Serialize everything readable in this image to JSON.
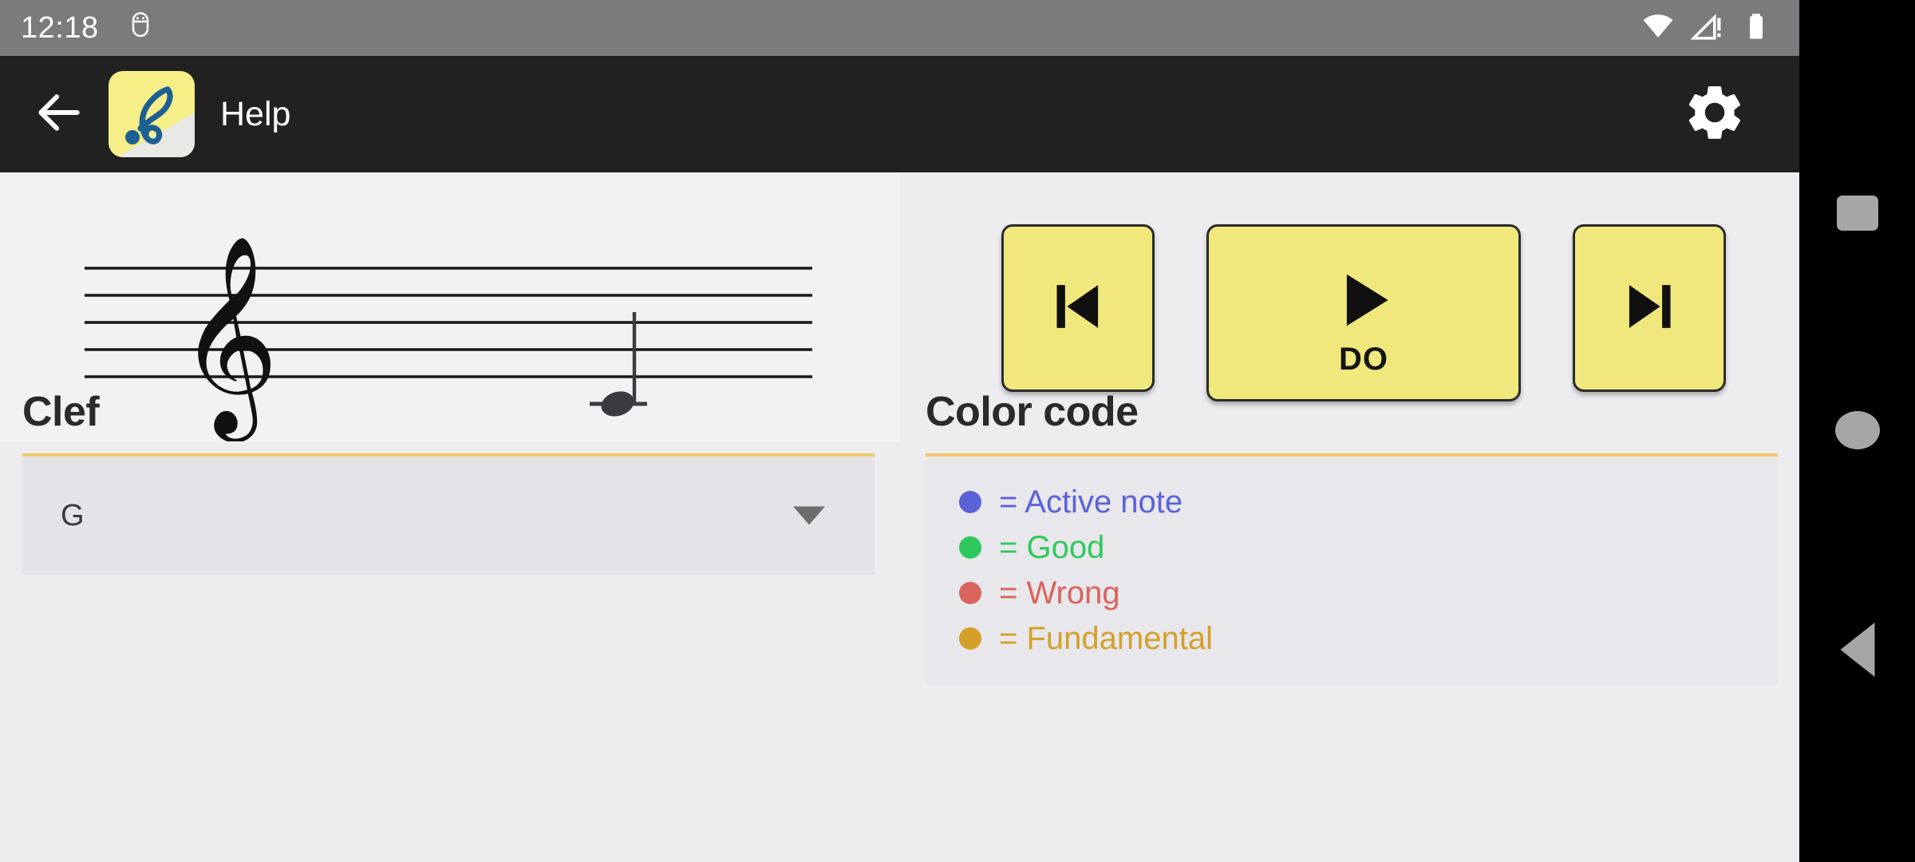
{
  "status_bar": {
    "clock": "12:18",
    "icons": [
      "android-head-icon",
      "wifi-icon",
      "cellular-no-sim-icon",
      "battery-full-icon"
    ]
  },
  "toolbar": {
    "back_icon": "back-arrow-icon",
    "logo_icon": "treble-clef-app-logo",
    "title": "Help",
    "settings_icon": "gear-icon"
  },
  "staff": {
    "clef_glyph": "treble-clef",
    "lines": 5,
    "note": {
      "name": "DO",
      "ledger_line": true,
      "stem": "up"
    }
  },
  "transport": {
    "previous_label": "",
    "previous_icon": "skip-previous-icon",
    "play_label": "DO",
    "play_icon": "play-icon",
    "next_label": "",
    "next_icon": "skip-next-icon"
  },
  "clef": {
    "title": "Clef",
    "selected": "G",
    "caret_icon": "chevron-down-icon"
  },
  "color_code": {
    "title": "Color code",
    "items": [
      {
        "label": "= Active note",
        "color": "#5a62d8"
      },
      {
        "label": "= Good",
        "color": "#2ec95c"
      },
      {
        "label": "= Wrong",
        "color": "#d8645c"
      },
      {
        "label": "= Fundamental",
        "color": "#d4a028"
      }
    ]
  },
  "nav_bar": {
    "recents_icon": "square-recents-icon",
    "home_icon": "circle-home-icon",
    "back_icon": "triangle-back-icon"
  },
  "colors": {
    "accent_yellow": "#f0e87d",
    "rule_yellow": "#f2ca6b",
    "toolbar_bg": "#212121",
    "status_bg": "#7b7b7e",
    "page_bg": "#edecef"
  }
}
